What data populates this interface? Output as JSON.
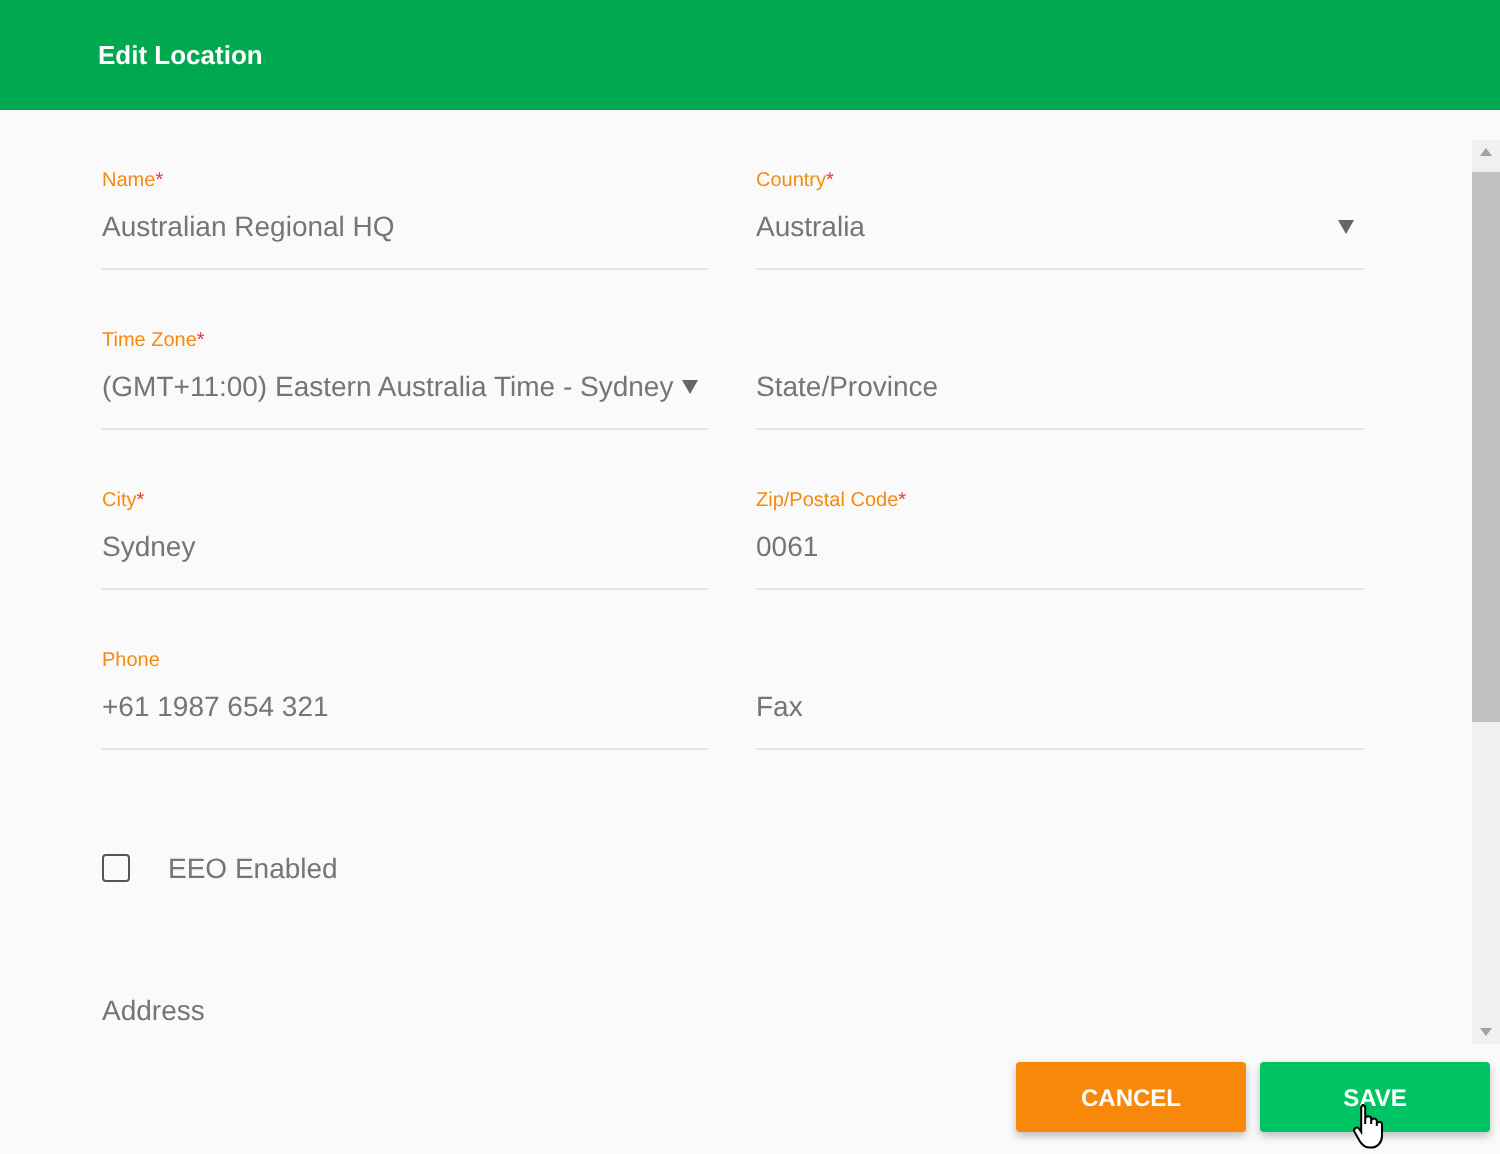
{
  "header": {
    "title": "Edit Location"
  },
  "fields": [
    {
      "kind": "text",
      "label": "Name",
      "required_mark": "*",
      "value": "Australian Regional HQ"
    },
    {
      "kind": "select",
      "label": "Country",
      "required_mark": "*",
      "value": "Australia"
    },
    {
      "kind": "select",
      "label": "Time Zone",
      "required_mark": "*",
      "value": "(GMT+11:00) Eastern Australia Time - Sydney"
    },
    {
      "kind": "text",
      "placeholder": "State/Province"
    },
    {
      "kind": "text",
      "label": "City",
      "required_mark": "*",
      "value": "Sydney"
    },
    {
      "kind": "text",
      "label": "Zip/Postal Code",
      "required_mark": "*",
      "value": "0061"
    },
    {
      "kind": "text",
      "label": "Phone",
      "value": "+61 1987 654 321"
    },
    {
      "kind": "text",
      "placeholder": "Fax"
    }
  ],
  "checkbox": {
    "label": "EEO Enabled",
    "checked": false
  },
  "address": {
    "placeholder": "Address"
  },
  "buttons": [
    {
      "kind": "cancel",
      "label": "CANCEL"
    },
    {
      "kind": "save",
      "label": "SAVE"
    }
  ]
}
